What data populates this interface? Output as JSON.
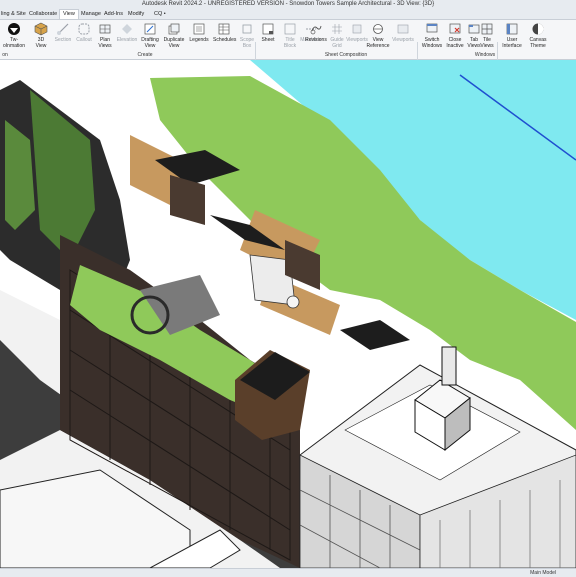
{
  "window": {
    "title": "Autodesk Revit 2024.2 - UNREGISTERED VERSION - Snowdon Towers Sample Architectural - 3D View: {3D}"
  },
  "tabs": [
    {
      "label": "ling & Site",
      "active": false
    },
    {
      "label": "Collaborate",
      "active": false
    },
    {
      "label": "View",
      "active": true
    },
    {
      "label": "Manage",
      "active": false
    },
    {
      "label": "Add-Ins",
      "active": false
    },
    {
      "label": "Modify",
      "active": false
    },
    {
      "label": "CQ •",
      "active": false
    }
  ],
  "ribbon": {
    "tools": [
      {
        "label": "Tw­oInmation",
        "icon": "twinmotion-icon",
        "enabled": true
      },
      {
        "label": "3D\nView",
        "icon": "3d-view-icon",
        "enabled": true
      },
      {
        "label": "Section",
        "icon": "section-icon",
        "enabled": false
      },
      {
        "label": "Callout",
        "icon": "callout-icon",
        "enabled": false
      },
      {
        "label": "Plan\nViews",
        "icon": "plan-views-icon",
        "enabled": true
      },
      {
        "label": "Elevation",
        "icon": "elevation-icon",
        "enabled": false
      },
      {
        "label": "Drafting\nView",
        "icon": "drafting-view-icon",
        "enabled": true
      },
      {
        "label": "Duplicate\nView",
        "icon": "duplicate-view-icon",
        "enabled": true
      },
      {
        "label": "Legends",
        "icon": "legends-icon",
        "enabled": true
      },
      {
        "label": "Schedules",
        "icon": "schedules-icon",
        "enabled": true
      },
      {
        "label": "Scope\nBox",
        "icon": "scope-box-icon",
        "enabled": false
      },
      {
        "label": "Sheet",
        "icon": "sheet-icon",
        "enabled": true
      },
      {
        "label": "Title\nBlock",
        "icon": "title-block-icon",
        "enabled": false
      },
      {
        "label": "Matchline",
        "icon": "matchline-icon",
        "enabled": false
      },
      {
        "label": "Revisions",
        "icon": "revisions-icon",
        "enabled": true
      },
      {
        "label": "Guide Grid",
        "icon": "guide-grid-icon",
        "enabled": false
      },
      {
        "label": "Viewports",
        "icon": "viewports-icon",
        "enabled": false
      },
      {
        "label": "View\nReference",
        "icon": "view-reference-icon",
        "enabled": true
      },
      {
        "label": "Viewports",
        "icon": "viewports-icon",
        "enabled": false
      },
      {
        "label": "Switch\nWindows",
        "icon": "switch-windows-icon",
        "enabled": true
      },
      {
        "label": "Close\nInactive",
        "icon": "close-inactive-icon",
        "enabled": true
      },
      {
        "label": "Tab\nViews",
        "icon": "tab-views-icon",
        "enabled": true
      },
      {
        "label": "Tile\nViews",
        "icon": "tile-views-icon",
        "enabled": true
      },
      {
        "label": "User\nInterface",
        "icon": "user-interface-icon",
        "enabled": true
      },
      {
        "label": "Canvas\nTheme",
        "icon": "canvas-theme-icon",
        "enabled": true
      }
    ],
    "groups": [
      {
        "label": "on"
      },
      {
        "label": "Create"
      },
      {
        "label": "Sheet Composition"
      },
      {
        "label": "Windows"
      }
    ]
  },
  "status": {
    "model": "Main Model"
  },
  "colors": {
    "roof_green": "#8fc95a",
    "water": "#7fe9f0",
    "accent_blue": "#1f4fd0"
  }
}
